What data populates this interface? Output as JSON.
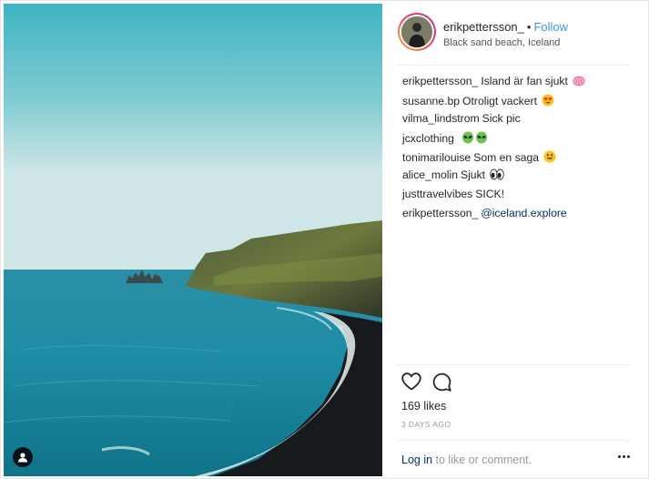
{
  "post": {
    "username": "erikpettersson_",
    "separator": "•",
    "follow_label": "Follow",
    "location": "Black sand beach, Iceland"
  },
  "comments": [
    {
      "user": "erikpettersson_",
      "text": "Island är fan sjukt",
      "emoji": "brain"
    },
    {
      "user": "susanne.bp",
      "text": "Otroligt vackert",
      "emoji": "heart-eyes"
    },
    {
      "user": "vilma_lindstrom",
      "text": "Sick pic",
      "emoji": ""
    },
    {
      "user": "jcxclothing",
      "text": "",
      "emoji": "alien-alien"
    },
    {
      "user": "tonimarilouise",
      "text": "Som en saga",
      "emoji": "smile"
    },
    {
      "user": "alice_molin",
      "text": "Sjukt",
      "emoji": "eyes"
    },
    {
      "user": "justtravelvibes",
      "text": "SICK!",
      "emoji": ""
    },
    {
      "user": "erikpettersson_",
      "text": "@iceland.explore",
      "emoji": ""
    }
  ],
  "stats": {
    "likes": "169 likes",
    "timestamp": "3 DAYS AGO"
  },
  "footer": {
    "login_link": "Log in",
    "login_rest": " to like or comment."
  },
  "icons": {
    "like": "heart-icon",
    "comment": "comment-icon",
    "more": "more-options-icon",
    "tag": "user-tag-icon"
  },
  "colors": {
    "link": "#3897f0",
    "mention": "#003569",
    "muted": "#999999",
    "text": "#262626"
  }
}
